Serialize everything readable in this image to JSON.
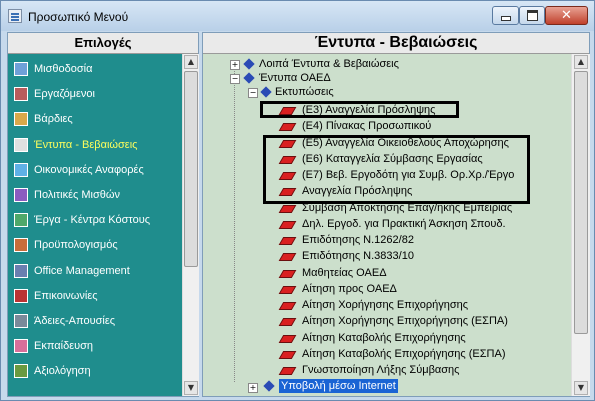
{
  "window": {
    "title": "Προσωπικό Μενού"
  },
  "left_panel": {
    "header": "Επιλογές",
    "items": [
      {
        "label": "Μισθοδοσία",
        "icon": "payroll-icon",
        "active": false
      },
      {
        "label": "Εργαζόμενοι",
        "icon": "employees-icon",
        "active": false
      },
      {
        "label": "Βάρδιες",
        "icon": "shifts-icon",
        "active": false
      },
      {
        "label": "Έντυπα - Βεβαιώσεις",
        "icon": "forms-icon",
        "active": true
      },
      {
        "label": "Οικονομικές Αναφορές",
        "icon": "financial-reports-icon",
        "active": false
      },
      {
        "label": "Πολιτικές Μισθών",
        "icon": "wage-policies-icon",
        "active": false
      },
      {
        "label": "Έργα - Κέντρα Κόστους",
        "icon": "projects-icon",
        "active": false
      },
      {
        "label": "Προϋπολογισμός",
        "icon": "budget-icon",
        "active": false
      },
      {
        "label": "Office Management",
        "icon": "office-icon",
        "active": false
      },
      {
        "label": "Επικοινωνίες",
        "icon": "communications-icon",
        "active": false
      },
      {
        "label": "Άδειες-Απουσίες",
        "icon": "leave-icon",
        "active": false
      },
      {
        "label": "Εκπαίδευση",
        "icon": "training-icon",
        "active": false
      },
      {
        "label": "Αξιολόγηση",
        "icon": "evaluation-icon",
        "active": false
      }
    ]
  },
  "right_panel": {
    "header": "Έντυπα - Βεβαιώσεις",
    "tree": {
      "other_forms": "Λοιπά Έντυπα & Βεβαιώσεις",
      "oaed_forms": "Έντυπα ΟΑΕΔ",
      "printouts": "Εκτυπώσεις",
      "items": [
        "(Ε3) Αναγγελία Πρόσληψης",
        "(Ε4) Πίνακας Προσωπικού",
        "(Ε5) Αναγγελία Οικειοθελούς Αποχώρησης",
        "(Ε6) Καταγγελία Σύμβασης Εργασίας",
        "(Ε7) Βεβ. Εργοδότη για Συμβ. Ορ.Χρ./Έργο",
        "Αναγγελία Πρόσληψης",
        "Σύμβαση Απόκτησης Επαγ/ηκής Εμπειρίας",
        "Δηλ. Εργοδ. για Πρακτική Άσκηση Σπουδ.",
        "Επιδότησης Ν.1262/82",
        "Επιδότησης Ν.3833/10",
        "Μαθητείας ΟΑΕΔ",
        "Αίτηση προς ΟΑΕΔ",
        "Αίτηση Χορήγησης Επιχορήγησης",
        "Αίτηση Χορήγησης Επιχορήγησης (ΕΣΠΑ)",
        "Αίτηση Καταβολής Επιχορήγησης",
        "Αίτηση Καταβολής Επιχορήγησης (ΕΣΠΑ)",
        "Γνωστοποίηση Λήξης Σύμβασης"
      ],
      "internet_submission": "Υποβολή μέσω Internet"
    }
  },
  "colors": {
    "menu_bg": "#1f8d8d",
    "tree_bg": "#ccdfcc",
    "active_label": "#ffff5c"
  }
}
